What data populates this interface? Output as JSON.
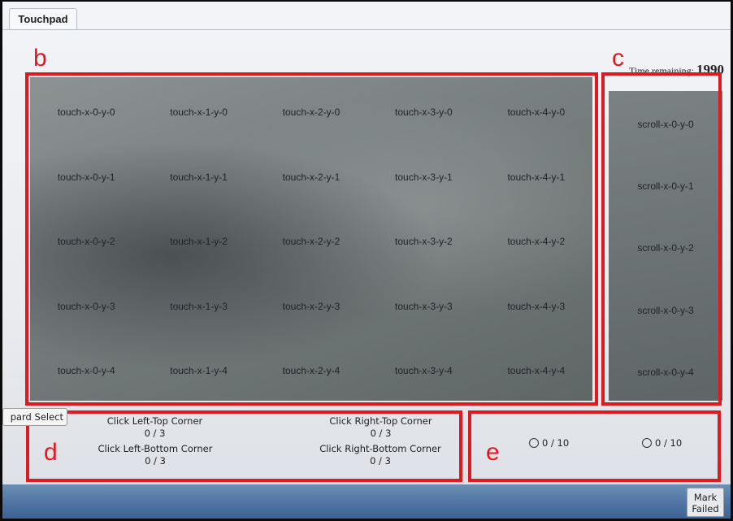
{
  "window": {
    "tab_label": "Touchpad"
  },
  "timer": {
    "label": "Time remaining: ",
    "value": "1990"
  },
  "annotations": {
    "b": "b",
    "c": "c",
    "d": "d",
    "e": "e"
  },
  "touch_grid": {
    "rows": [
      [
        "touch-x-0-y-0",
        "touch-x-1-y-0",
        "touch-x-2-y-0",
        "touch-x-3-y-0",
        "touch-x-4-y-0"
      ],
      [
        "touch-x-0-y-1",
        "touch-x-1-y-1",
        "touch-x-2-y-1",
        "touch-x-3-y-1",
        "touch-x-4-y-1"
      ],
      [
        "touch-x-0-y-2",
        "touch-x-1-y-2",
        "touch-x-2-y-2",
        "touch-x-3-y-2",
        "touch-x-4-y-2"
      ],
      [
        "touch-x-0-y-3",
        "touch-x-1-y-3",
        "touch-x-2-y-3",
        "touch-x-3-y-3",
        "touch-x-4-y-3"
      ],
      [
        "touch-x-0-y-4",
        "touch-x-1-y-4",
        "touch-x-2-y-4",
        "touch-x-3-y-4",
        "touch-x-4-y-4"
      ]
    ]
  },
  "scroll_column": [
    "scroll-x-0-y-0",
    "scroll-x-0-y-1",
    "scroll-x-0-y-2",
    "scroll-x-0-y-3",
    "scroll-x-0-y-4"
  ],
  "board_select_label": "pard Select",
  "corners": {
    "left_top": {
      "label": "Click Left-Top Corner",
      "count": "0 / 3"
    },
    "right_top": {
      "label": "Click Right-Top Corner",
      "count": "0 / 3"
    },
    "left_bottom": {
      "label": "Click Left-Bottom Corner",
      "count": "0 / 3"
    },
    "right_bottom": {
      "label": "Click Right-Bottom Corner",
      "count": "0 / 3"
    }
  },
  "clicks": [
    {
      "count": "0 / 10"
    },
    {
      "count": "0 / 10"
    }
  ],
  "mark_failed": {
    "line1": "Mark",
    "line2": "Failed"
  },
  "colors": {
    "annotation": "#e0191f",
    "taskbar": "#4d72a1"
  }
}
